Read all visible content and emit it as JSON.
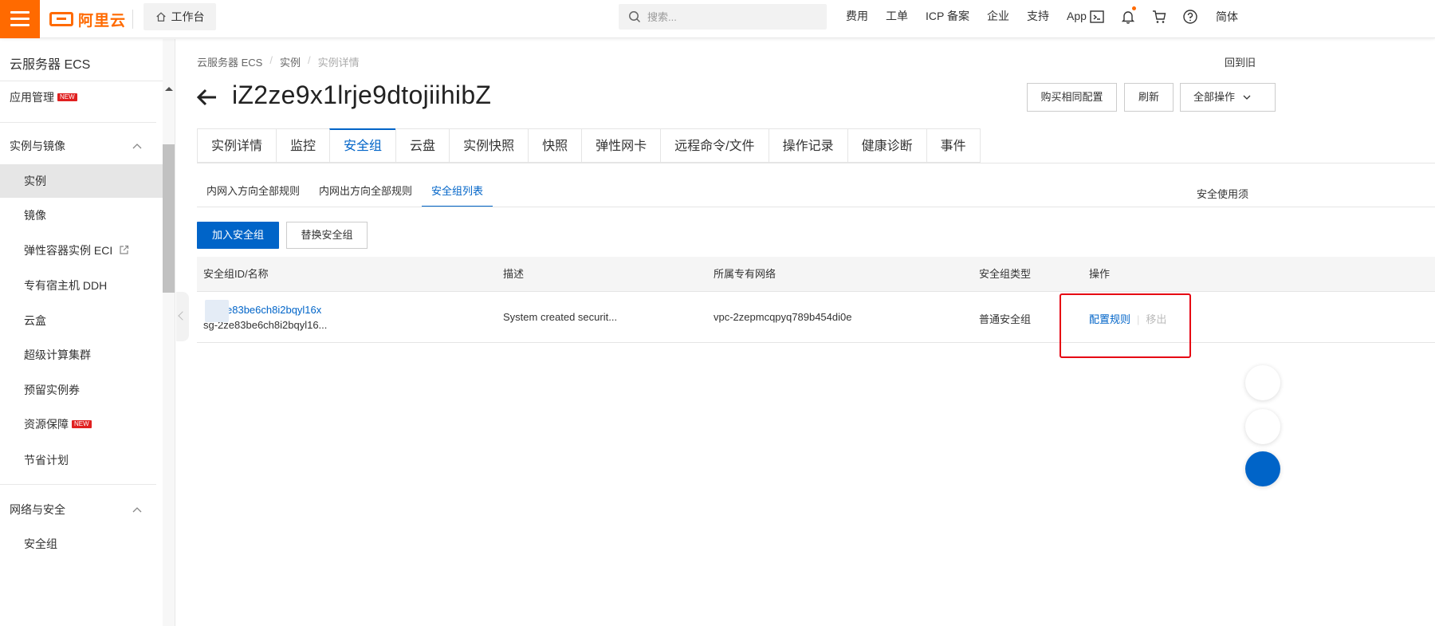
{
  "header": {
    "logo_text": "阿里云",
    "workbench_label": "工作台",
    "search_placeholder": "搜索...",
    "nav": [
      "费用",
      "工单",
      "ICP 备案",
      "企业",
      "支持",
      "App"
    ],
    "language": "简体",
    "icons": [
      "terminal-icon",
      "bell-icon",
      "cart-icon",
      "help-icon"
    ],
    "brand_color": "#ff6a00"
  },
  "sidebar": {
    "title": "云服务器 ECS",
    "app_mgmt": "应用管理",
    "new_badge": "NEW",
    "group_instances": "实例与镜像",
    "items": {
      "instance": "实例",
      "image": "镜像",
      "eci": "弹性容器实例 ECI",
      "ddh": "专有宿主机 DDH",
      "cloudbox": "云盒",
      "hpc": "超级计算集群",
      "reserved": "预留实例券",
      "resource": "资源保障",
      "savings": "节省计划"
    },
    "group_network": "网络与安全",
    "security_group": "安全组"
  },
  "breadcrumb": [
    "云服务器 ECS",
    "实例",
    "实例详情"
  ],
  "back_to": "回到旧",
  "instance": {
    "id": "iZ2ze9x1lrje9dtojiihibZ"
  },
  "actions": {
    "buy_same": "购买相同配置",
    "refresh": "刷新",
    "all_ops": "全部操作"
  },
  "tabs": [
    "实例详情",
    "监控",
    "安全组",
    "云盘",
    "实例快照",
    "快照",
    "弹性网卡",
    "远程命令/文件",
    "操作记录",
    "健康诊断",
    "事件"
  ],
  "active_tab": 2,
  "subtabs": [
    "内网入方向全部规则",
    "内网出方向全部规则",
    "安全组列表"
  ],
  "active_subtab": 2,
  "notice_link": "安全使用须",
  "buttons": {
    "join": "加入安全组",
    "replace": "替换安全组"
  },
  "table": {
    "columns": [
      "安全组ID/名称",
      "描述",
      "所属专有网络",
      "安全组类型",
      "操作"
    ],
    "rows": [
      {
        "id_link": "e83be6ch8i2bqyl16x",
        "name": "sg-2ze83be6ch8i2bqyl16...",
        "description": "System created securit...",
        "vpc": "vpc-2zepmcqpyq789b454di0e",
        "type": "普通安全组",
        "op_config": "配置规则",
        "op_sep": "|",
        "op_remove": "移出"
      }
    ]
  },
  "colors": {
    "accent": "#0064c8",
    "highlight": "#e60012"
  }
}
